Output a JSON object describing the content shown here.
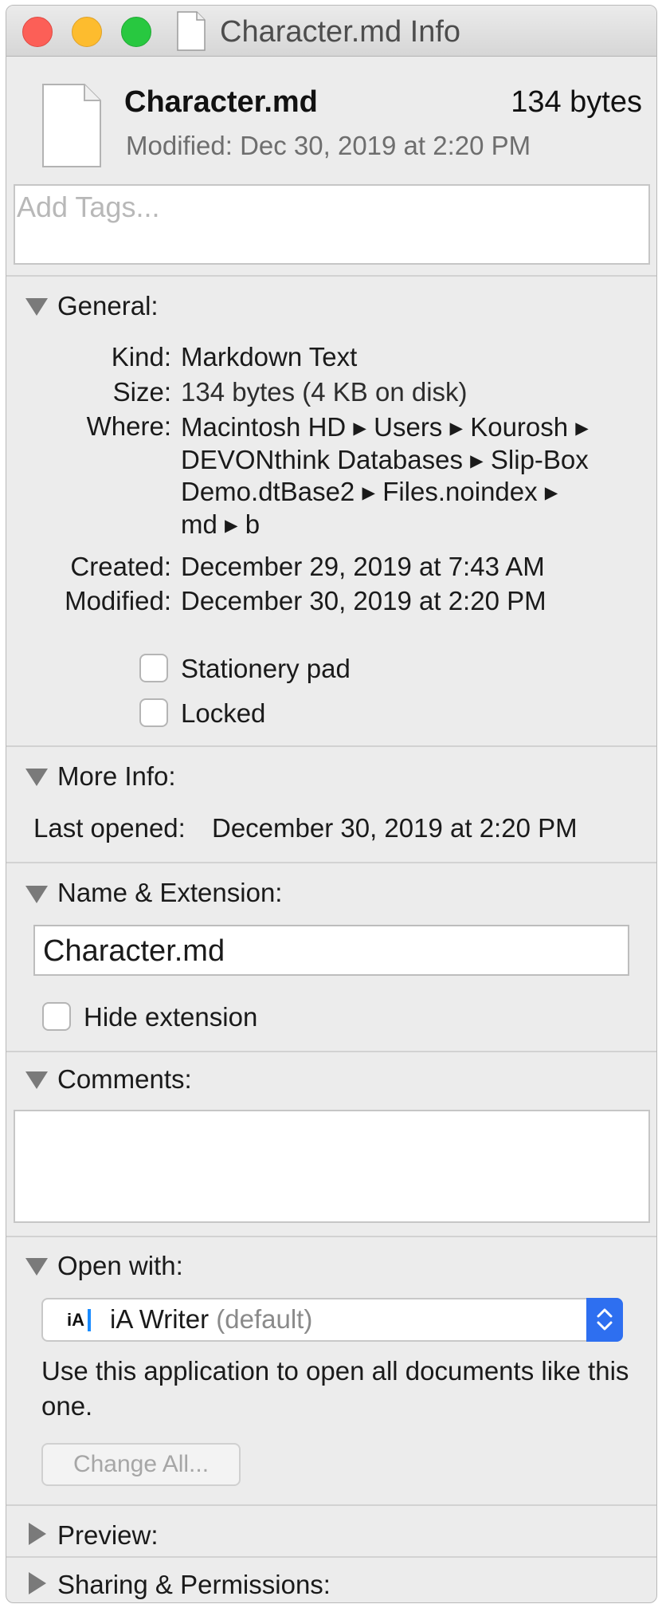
{
  "window": {
    "title": "Character.md Info",
    "buttons": {
      "close": "close-button",
      "minimize": "minimize-button",
      "zoom": "zoom-button"
    }
  },
  "header": {
    "file_name": "Character.md",
    "file_size": "134 bytes",
    "modified": "Modified: Dec 30, 2019 at 2:20 PM",
    "icon": "document-icon"
  },
  "tags": {
    "placeholder": "Add Tags..."
  },
  "general": {
    "title": "General:",
    "expanded": true,
    "kind_label": "Kind:",
    "kind": "Markdown Text",
    "size_label": "Size:",
    "size": "134 bytes (4 KB on disk)",
    "where_label": "Where:",
    "where_lines": [
      "Macintosh HD ▸ Users ▸ Kourosh ▸",
      "DEVONthink Databases ▸ Slip-Box",
      "Demo.dtBase2 ▸ Files.noindex ▸",
      "md ▸ b"
    ],
    "created_label": "Created:",
    "created": "December 29, 2019 at 7:43 AM",
    "modified_label": "Modified:",
    "modified": "December 30, 2019 at 2:20 PM",
    "stationery_label": "Stationery pad",
    "stationery_checked": false,
    "locked_label": "Locked",
    "locked_checked": false
  },
  "more_info": {
    "title": "More Info:",
    "expanded": true,
    "last_opened_label": "Last opened:",
    "last_opened": "December 30, 2019 at 2:20 PM"
  },
  "name_extension": {
    "title": "Name & Extension:",
    "expanded": true,
    "name_value": "Character.md",
    "hide_extension_label": "Hide extension",
    "hide_extension_checked": false
  },
  "comments": {
    "title": "Comments:",
    "expanded": true,
    "value": ""
  },
  "open_with": {
    "title": "Open with:",
    "expanded": true,
    "app_icon_text": "iA",
    "app_name": "iA Writer",
    "app_suffix": "(default)",
    "description": "Use this application to open all documents like this one.",
    "change_all_label": "Change All..."
  },
  "preview": {
    "title": "Preview:",
    "expanded": false
  },
  "sharing": {
    "title": "Sharing & Permissions:",
    "expanded": false
  },
  "colors": {
    "close": "#fc5f57",
    "minimize": "#fdbc2e",
    "zoom": "#28c840",
    "accent": "#2e6ff0"
  }
}
